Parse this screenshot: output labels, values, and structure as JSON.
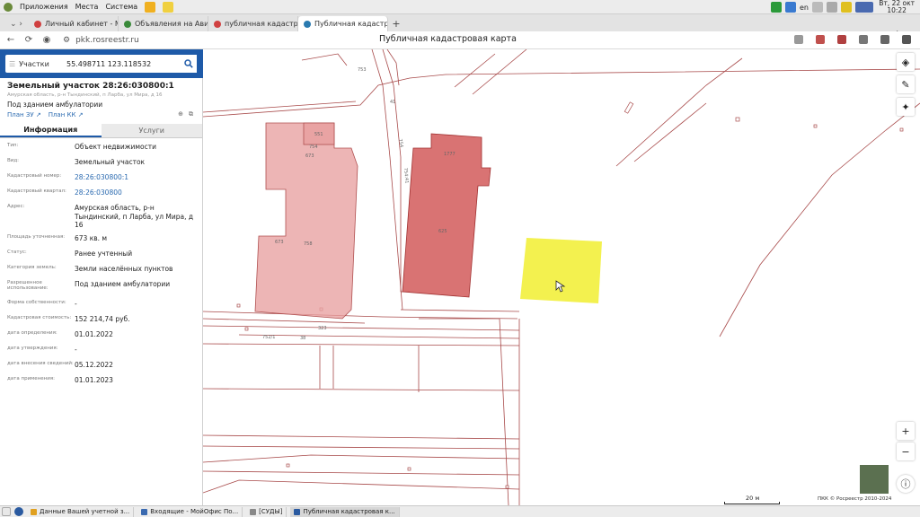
{
  "system_bar": {
    "menus": [
      "Приложения",
      "Места",
      "Система"
    ],
    "keyboard_layout": "en",
    "clock_day": "Вт, 22 окт",
    "clock_time": "10:22"
  },
  "browser": {
    "tabs": [
      {
        "label": "Личный кабинет - Мо",
        "color": "#d04040"
      },
      {
        "label": "Объявления на Авито",
        "color": "#3a8a3a"
      },
      {
        "label": "публичная кадастров",
        "color": "#d04040"
      },
      {
        "label": "Публичная кадастр",
        "color": "#2a7ab0",
        "active": true
      }
    ],
    "url": "pkk.rosreestr.ru",
    "page_title": "Публичная кадастровая карта"
  },
  "panel": {
    "search_type": "Участки",
    "search_value": "55.498711 123.118532",
    "object_title": "Земельный участок 28:26:030800:1",
    "object_address": "Амурская область, р-н Тындинский, п Ларба, ул Мира, д 16",
    "object_use": "Под зданием амбулатории",
    "plan_zu": "План ЗУ",
    "plan_kk": "План КК",
    "tab_info": "Информация",
    "tab_services": "Услуги",
    "rows": [
      {
        "k": "Тип:",
        "v": "Объект недвижимости"
      },
      {
        "k": "Вид:",
        "v": "Земельный участок"
      },
      {
        "k": "Кадастровый номер:",
        "v": "28:26:030800:1",
        "link": true
      },
      {
        "k": "Кадастровый квартал:",
        "v": "28:26:030800",
        "link": true
      },
      {
        "k": "Адрес:",
        "v": "Амурская область, р-н Тындинский, п Ларба, ул Мира, д 16"
      },
      {
        "k": "Площадь уточненная:",
        "v": "673 кв. м"
      },
      {
        "k": "Статус:",
        "v": "Ранее учтенный"
      },
      {
        "k": "Категория земель:",
        "v": "Земли населённых пунктов"
      },
      {
        "k": "Разрешенное использование:",
        "v": "Под зданием амбулатории"
      },
      {
        "k": "Форма собственности:",
        "v": "-"
      },
      {
        "k": "Кадастровая стоимость:",
        "v": "152 214,74 руб."
      },
      {
        "k": "дата определения:",
        "v": "01.01.2022"
      },
      {
        "k": "дата утверждения:",
        "v": "-"
      },
      {
        "k": "дата внесения сведений:",
        "v": "05.12.2022"
      },
      {
        "k": "дата применения:",
        "v": "01.01.2023"
      }
    ]
  },
  "map": {
    "labels": {
      "l753": "753",
      "l41": "41",
      "l754": "754",
      "l75441": "754:41",
      "l551": "551",
      "l754b": "754",
      "l673": "673",
      "l673b": "673",
      "l758": "758",
      "l1777": "1777",
      "l625": "625",
      "l323": "323",
      "l7521": "752/1",
      "l38": "38"
    },
    "scale_label": "20 м",
    "copyright": "ПКК © Росреестр 2010-2024",
    "plus": "+",
    "minus": "−"
  },
  "taskbar": {
    "items": [
      {
        "label": "Данные Вашей учетной з...",
        "color": "#e0a020"
      },
      {
        "label": "Входящие - МойОфис По...",
        "color": "#3a6ab0"
      },
      {
        "label": "[СУДЫ]",
        "color": "#888888"
      },
      {
        "label": "Публичная кадастровая к...",
        "color": "#2a5aa0",
        "active": true
      }
    ]
  }
}
